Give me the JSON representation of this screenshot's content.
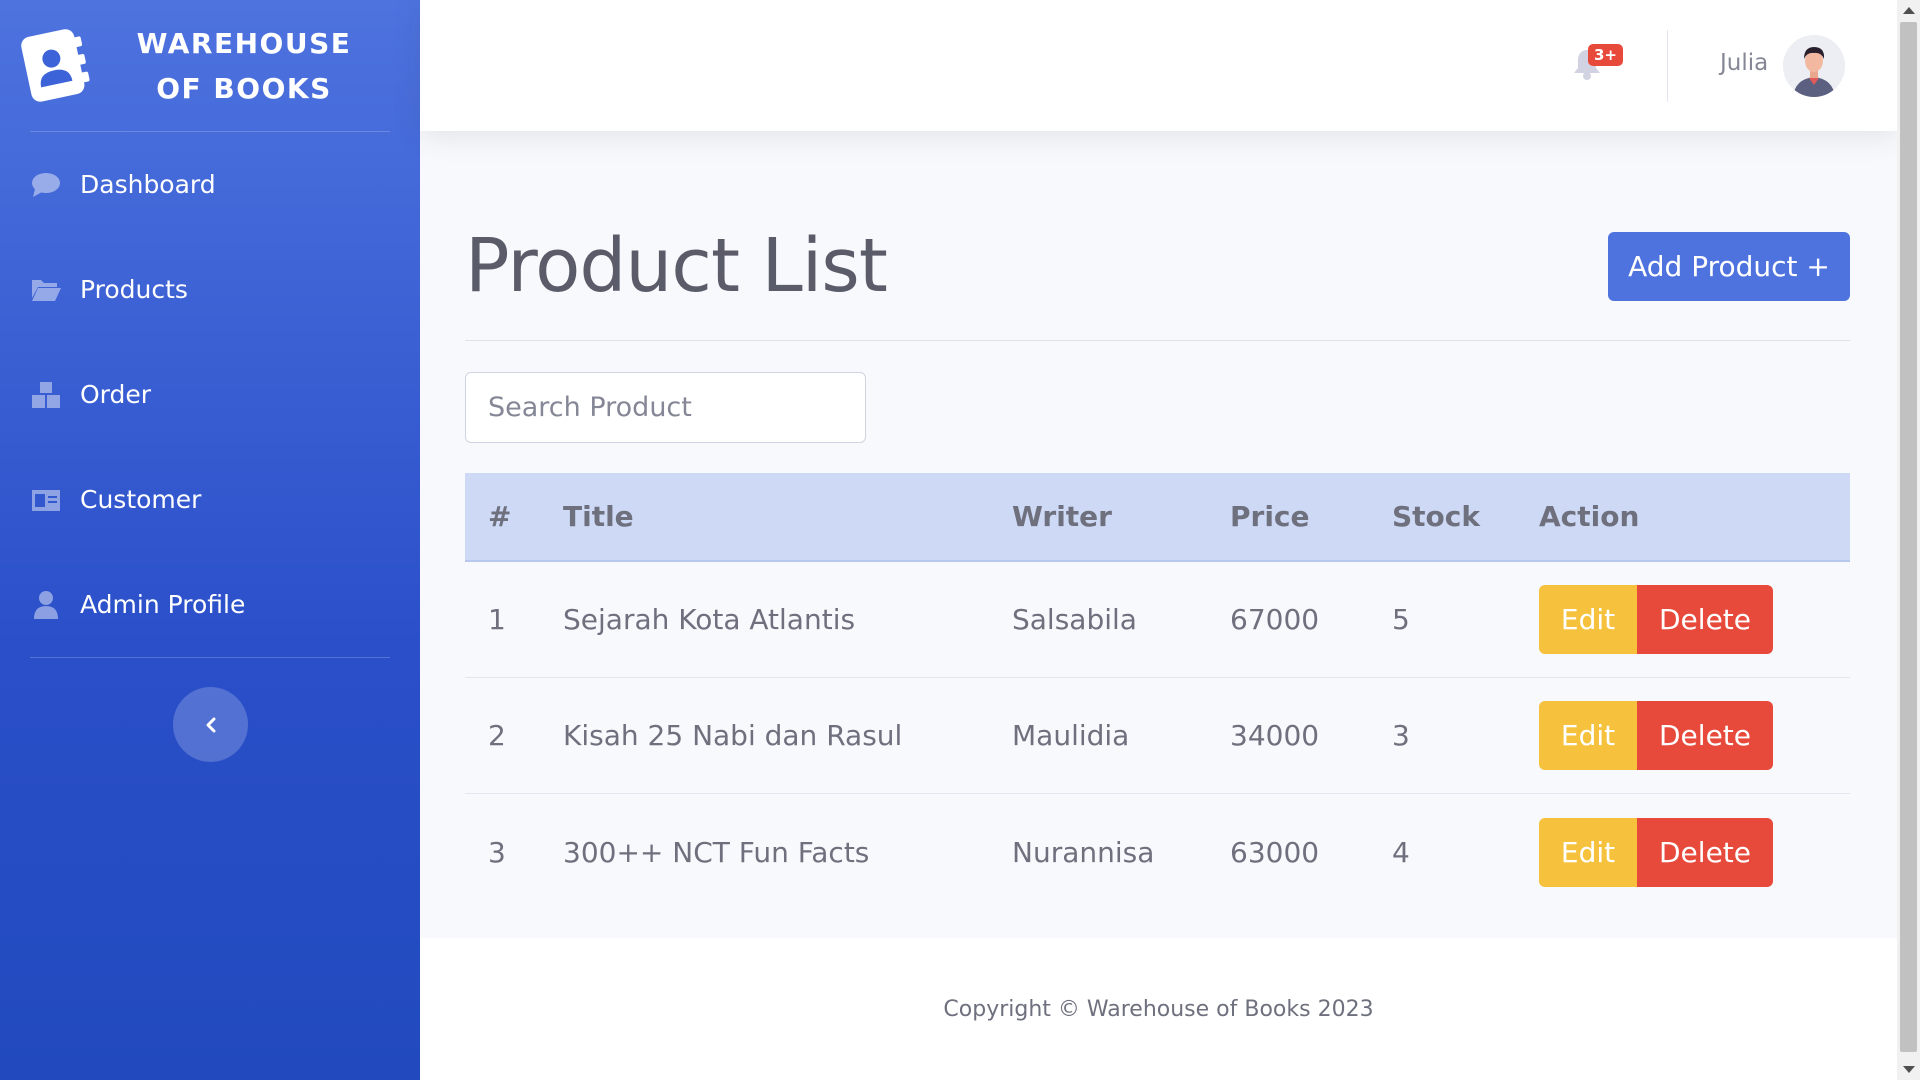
{
  "brand": {
    "line1": "WAREHOUSE",
    "line2": "OF BOOKS",
    "icon": "address-book-icon"
  },
  "sidebar": {
    "items": [
      {
        "label": "Dashboard",
        "icon": "comment-icon"
      },
      {
        "label": "Products",
        "icon": "folder-open-icon"
      },
      {
        "label": "Order",
        "icon": "boxes-icon"
      },
      {
        "label": "Customer",
        "icon": "id-card-icon"
      },
      {
        "label": "Admin Profile",
        "icon": "user-icon"
      }
    ],
    "toggle_icon": "chevron-left-icon"
  },
  "topbar": {
    "notification_badge": "3+",
    "username": "Julia"
  },
  "page": {
    "title": "Product List",
    "add_button": "Add Product +",
    "search_placeholder": "Search Product"
  },
  "table": {
    "headers": [
      "#",
      "Title",
      "Writer",
      "Price",
      "Stock",
      "Action"
    ],
    "rows": [
      {
        "no": "1",
        "title": "Sejarah Kota Atlantis",
        "writer": "Salsabila",
        "price": "67000",
        "stock": "5"
      },
      {
        "no": "2",
        "title": "Kisah 25 Nabi dan Rasul",
        "writer": "Maulidia",
        "price": "34000",
        "stock": "3"
      },
      {
        "no": "3",
        "title": "300++ NCT Fun Facts",
        "writer": "Nurannisa",
        "price": "63000",
        "stock": "4"
      }
    ],
    "edit_label": "Edit",
    "delete_label": "Delete"
  },
  "footer": {
    "text": "Copyright © Warehouse of Books 2023"
  },
  "colors": {
    "primary": "#4e73df",
    "warning": "#f6c23e",
    "danger": "#e74a3b",
    "table_header": "#cdd9f5"
  }
}
